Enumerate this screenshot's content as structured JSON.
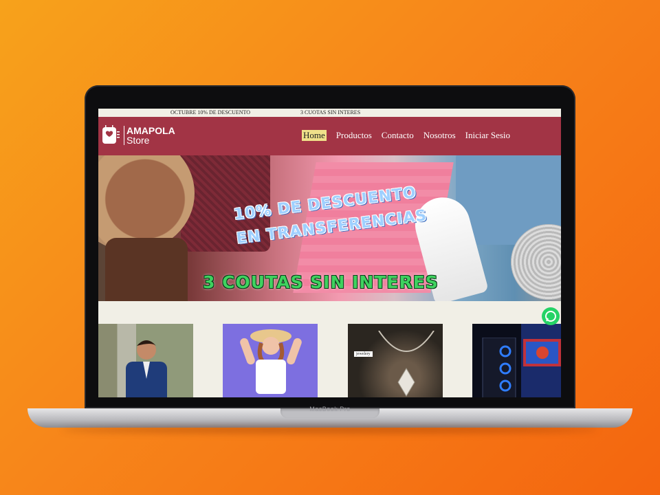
{
  "device": {
    "label": "MacBook Pro"
  },
  "announcement": {
    "left": "OCTUBRE 10% DE DESCUENTO",
    "right": "3 CUOTAS SIN INTERES"
  },
  "logo": {
    "line1": "AMAPOLA",
    "line2": "Store"
  },
  "nav": {
    "items": [
      "Home",
      "Productos",
      "Contacto",
      "Nosotros",
      "Iniciar Sesio"
    ],
    "active": "Home"
  },
  "hero": {
    "line1": "10% DE DESCUENTO",
    "line2": "EN TRANSFERENCIAS",
    "line3": "3 COUTAS SIN INTERES"
  },
  "cards": [
    {
      "name": "men"
    },
    {
      "name": "women"
    },
    {
      "name": "jewelery",
      "tag": "jewelery"
    },
    {
      "name": "electronics"
    }
  ],
  "colors": {
    "header": "#a23445",
    "nav_active": "#f0e18a",
    "hero_text_blue": "#9fd0ff",
    "hero_text_green": "#3fd25f",
    "whatsapp": "#25d366"
  }
}
